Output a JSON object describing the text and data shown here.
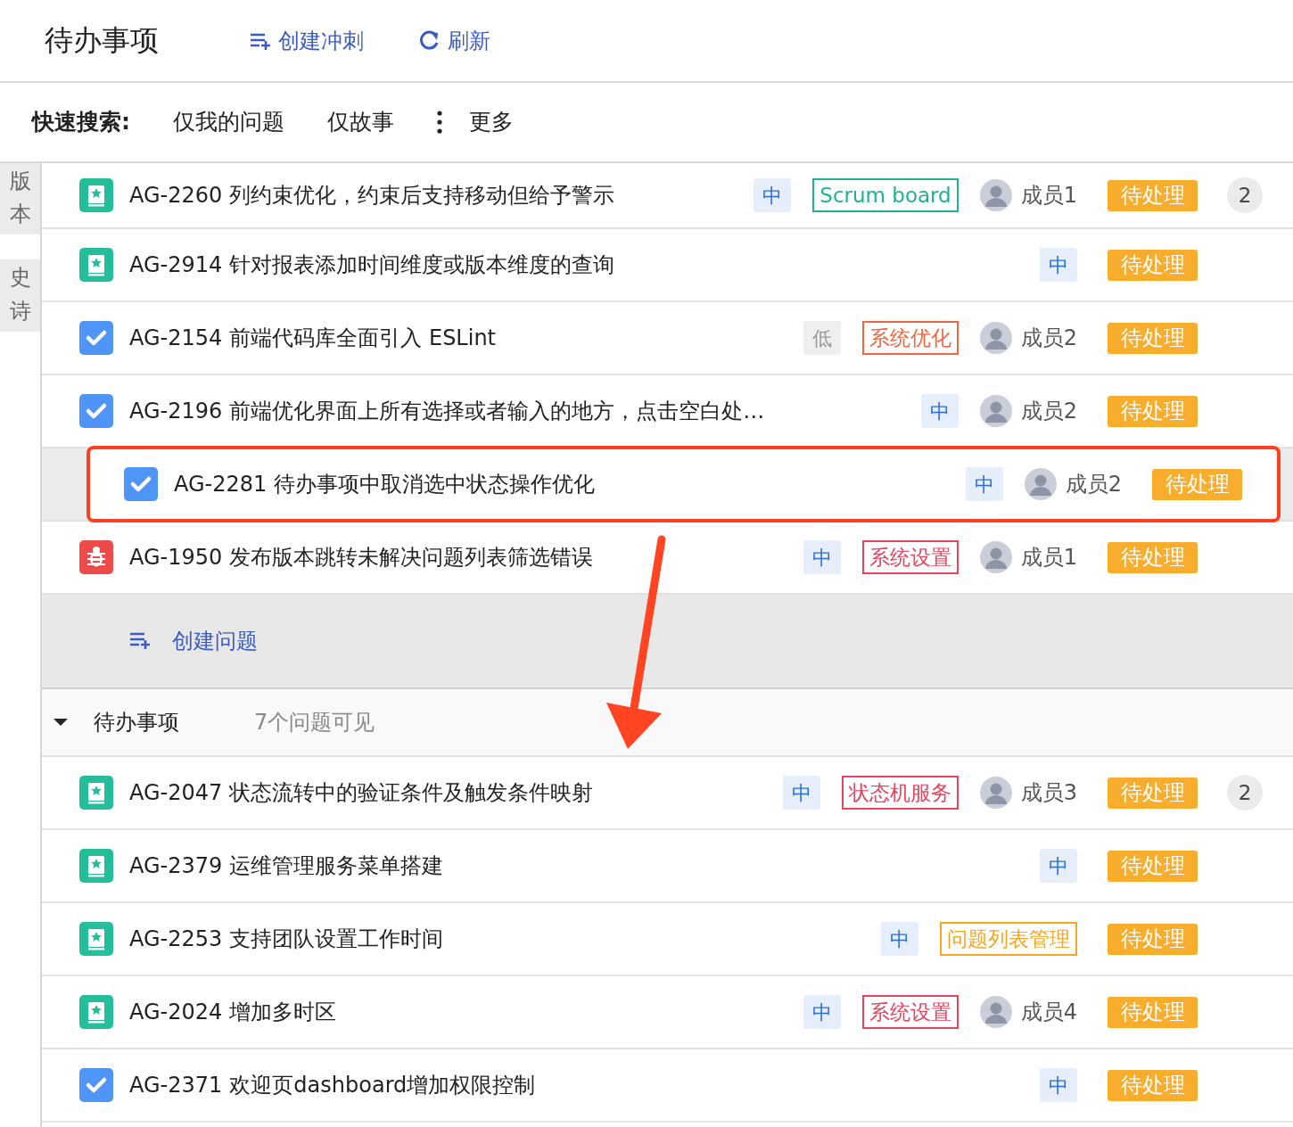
{
  "title": "待办事项",
  "header_actions": [
    {
      "kind": "create",
      "label": "创建冲刺"
    },
    {
      "kind": "refresh",
      "label": "刷新"
    }
  ],
  "quick_search": {
    "label": "快速搜索:",
    "filters": [
      "仅我的问题",
      "仅故事"
    ],
    "more": "更多"
  },
  "side_tabs": [
    "版本",
    "史诗"
  ],
  "sprint_issues": [
    {
      "kind": "story",
      "key": "AG-2260",
      "summary": "列约束优化，约束后支持移动但给予警示",
      "priority": {
        "label": "中",
        "kind": "medium"
      },
      "tag": {
        "text": "Scrum board",
        "color": "#1cb394"
      },
      "assignee": "成员1",
      "status": "待处理",
      "comments": "2",
      "highlighted": false
    },
    {
      "kind": "story",
      "key": "AG-2914",
      "summary": "针对报表添加时间维度或版本维度的查询",
      "priority": {
        "label": "中",
        "kind": "medium"
      },
      "status": "待处理",
      "highlighted": false
    },
    {
      "kind": "task",
      "key": "AG-2154",
      "summary": "前端代码库全面引入 ESLint",
      "priority": {
        "label": "低",
        "kind": "low"
      },
      "tag": {
        "text": "系统优化",
        "color": "#f5633f"
      },
      "assignee": "成员2",
      "status": "待处理",
      "highlighted": false
    },
    {
      "kind": "task",
      "key": "AG-2196",
      "summary": "前端优化界面上所有选择或者输入的地方，点击空白处…",
      "priority": {
        "label": "中",
        "kind": "medium"
      },
      "assignee": "成员2",
      "status": "待处理",
      "highlighted": false
    },
    {
      "kind": "task",
      "key": "AG-2281",
      "summary": "待办事项中取消选中状态操作优化",
      "priority": {
        "label": "中",
        "kind": "medium"
      },
      "assignee": "成员2",
      "status": "待处理",
      "highlighted": true
    },
    {
      "kind": "bug",
      "key": "AG-1950",
      "summary": "发布版本跳转未解决问题列表筛选错误",
      "priority": {
        "label": "中",
        "kind": "medium"
      },
      "tag": {
        "text": "系统设置",
        "color": "#e8435f"
      },
      "assignee": "成员1",
      "status": "待处理",
      "highlighted": false
    }
  ],
  "create_issue": "创建问题",
  "backlog": {
    "title": "待办事项",
    "count": "7个问题可见",
    "expanded": true,
    "issues": [
      {
        "kind": "story",
        "key": "AG-2047",
        "summary": "状态流转中的验证条件及触发条件映射",
        "priority": {
          "label": "中",
          "kind": "medium"
        },
        "tag": {
          "text": "状态机服务",
          "color": "#e8435f"
        },
        "assignee": "成员3",
        "status": "待处理",
        "comments": "2",
        "highlighted": false
      },
      {
        "kind": "story",
        "key": "AG-2379",
        "summary": "运维管理服务菜单搭建",
        "priority": {
          "label": "中",
          "kind": "medium"
        },
        "status": "待处理",
        "highlighted": false
      },
      {
        "kind": "story",
        "key": "AG-2253",
        "summary": "支持团队设置工作时间",
        "priority": {
          "label": "中",
          "kind": "medium"
        },
        "tag": {
          "text": "问题列表管理",
          "color": "#f5a623"
        },
        "status": "待处理",
        "highlighted": false
      },
      {
        "kind": "story",
        "key": "AG-2024",
        "summary": "增加多时区",
        "priority": {
          "label": "中",
          "kind": "medium"
        },
        "tag": {
          "text": "系统设置",
          "color": "#e8435f"
        },
        "assignee": "成员4",
        "status": "待处理",
        "highlighted": false
      },
      {
        "kind": "task",
        "key": "AG-2371",
        "summary": "欢迎页dashboard增加权限控制",
        "priority": {
          "label": "中",
          "kind": "medium"
        },
        "status": "待处理",
        "highlighted": false
      }
    ]
  }
}
